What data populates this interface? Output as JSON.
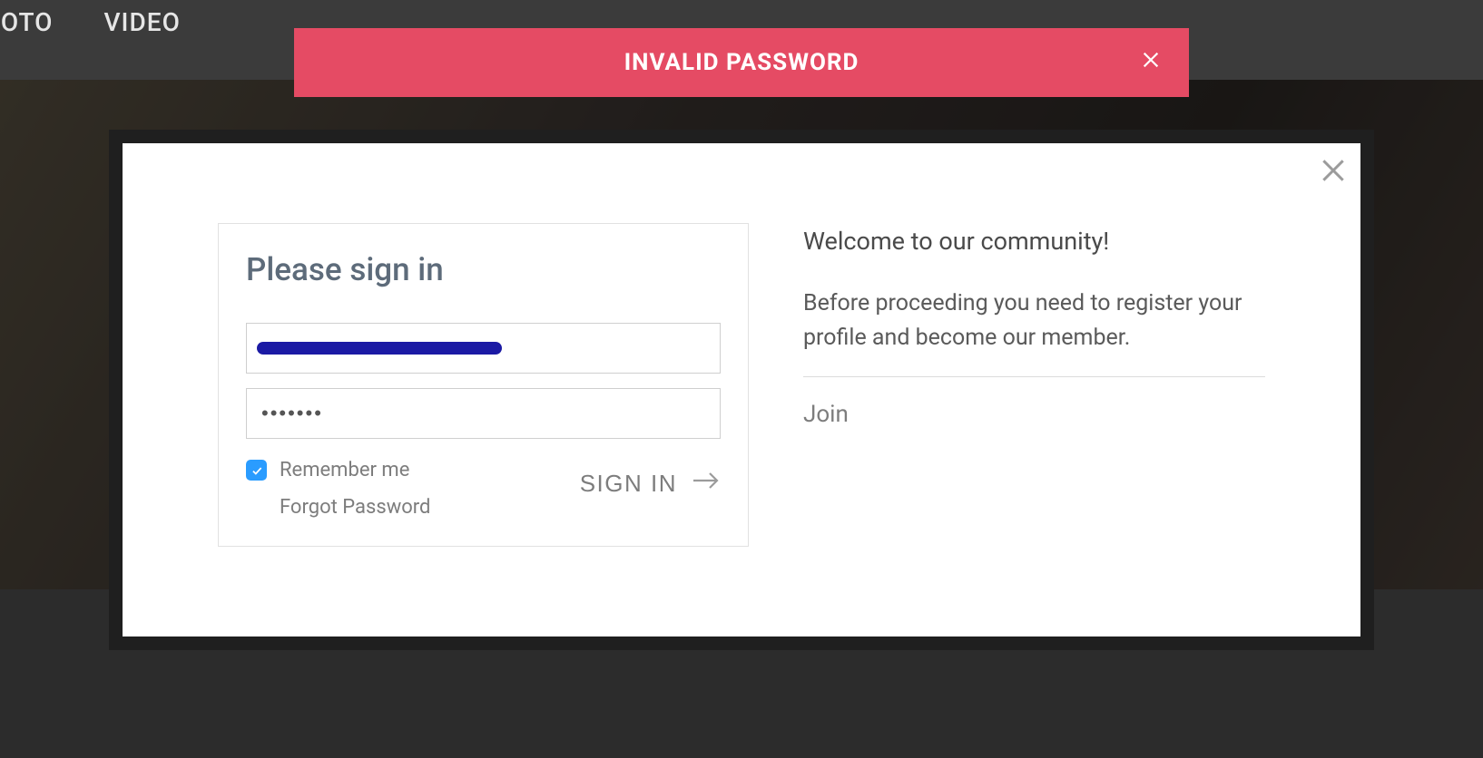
{
  "nav": {
    "item1": "HOTO",
    "item2": "VIDEO"
  },
  "toast": {
    "message": "INVALID PASSWORD"
  },
  "signin": {
    "title": "Please sign in",
    "email_value": "",
    "password_value": "•••••••",
    "remember_label": "Remember me",
    "remember_checked": true,
    "forgot_label": "Forgot Password",
    "submit_label": "SIGN IN"
  },
  "welcome": {
    "heading": "Welcome to our community!",
    "body": "Before proceeding you need to register your profile and become our member.",
    "join_label": "Join"
  }
}
